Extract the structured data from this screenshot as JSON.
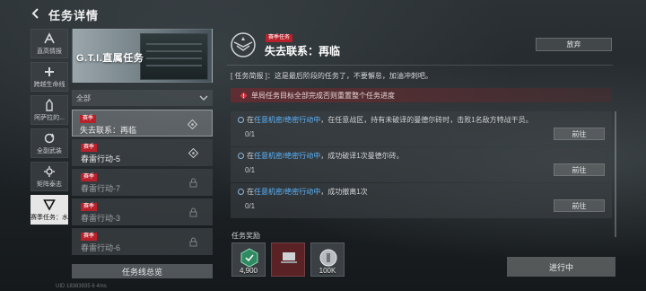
{
  "header": {
    "title": "任务详情"
  },
  "rail": {
    "items": [
      {
        "label": "直高情报",
        "icon": "chevron-a-icon"
      },
      {
        "label": "跨越生命线",
        "icon": "plus-icon"
      },
      {
        "label": "阿萨拉的...",
        "icon": "tower-icon"
      },
      {
        "label": "全副武装",
        "icon": "refresh-icon"
      },
      {
        "label": "矩阵泰志",
        "icon": "gear-icon"
      },
      {
        "label": "赛季任务：水",
        "icon": "triangle-icon",
        "active": true
      }
    ]
  },
  "list": {
    "banner_title": "G.T.I.直属任务",
    "filter_label": "全部",
    "tasks": [
      {
        "badge": "赛季",
        "name": "失去联系：再临",
        "active": true
      },
      {
        "badge": "赛季",
        "name": "春雷行动-5"
      },
      {
        "badge": "赛季",
        "name": "春雷行动-7",
        "dim": true
      },
      {
        "badge": "赛季",
        "name": "春雷行动-3",
        "dim": true
      },
      {
        "badge": "赛季",
        "name": "春雷行动-6",
        "dim": true
      }
    ],
    "overview_button": "任务线总览"
  },
  "detail": {
    "badge": "赛季任务",
    "title": "失去联系：再临",
    "abandon_button": "放弃",
    "brief": "[ 任务简报 ]：这是最后阶段的任务了，不要懈怠，加油冲刺吧。",
    "warning": "单局任务目标全部完成否则重置整个任务进度",
    "objectives": [
      {
        "prefix": "在",
        "highlight": "任意机密/绝密行动中",
        "text": "，在任意战区，持有未破译的曼德尔砖时，击败1名敌方特战干员。",
        "progress": "0/1",
        "button": "前往"
      },
      {
        "prefix": "在",
        "highlight": "任意机密/绝密行动中",
        "text": "，成功破译1次曼德尔砖。",
        "progress": "0/1",
        "button": "前往"
      },
      {
        "prefix": "在",
        "highlight": "任意机密/绝密行动中",
        "text": "，成功撤离1次",
        "progress": "0/1",
        "button": "前往"
      }
    ]
  },
  "rewards": {
    "label": "任务奖励",
    "items": [
      {
        "qty": "4,900",
        "icon": "emblem-icon"
      },
      {
        "qty": "",
        "icon": "laptop-icon"
      },
      {
        "qty": "100K",
        "icon": "coin-icon"
      }
    ]
  },
  "status_button": "进行中",
  "footer": "UID 18383935  6  4ms",
  "colors": {
    "highlight": "#5fb6ff",
    "badge": "#b8202a",
    "warning": "#78282d"
  }
}
